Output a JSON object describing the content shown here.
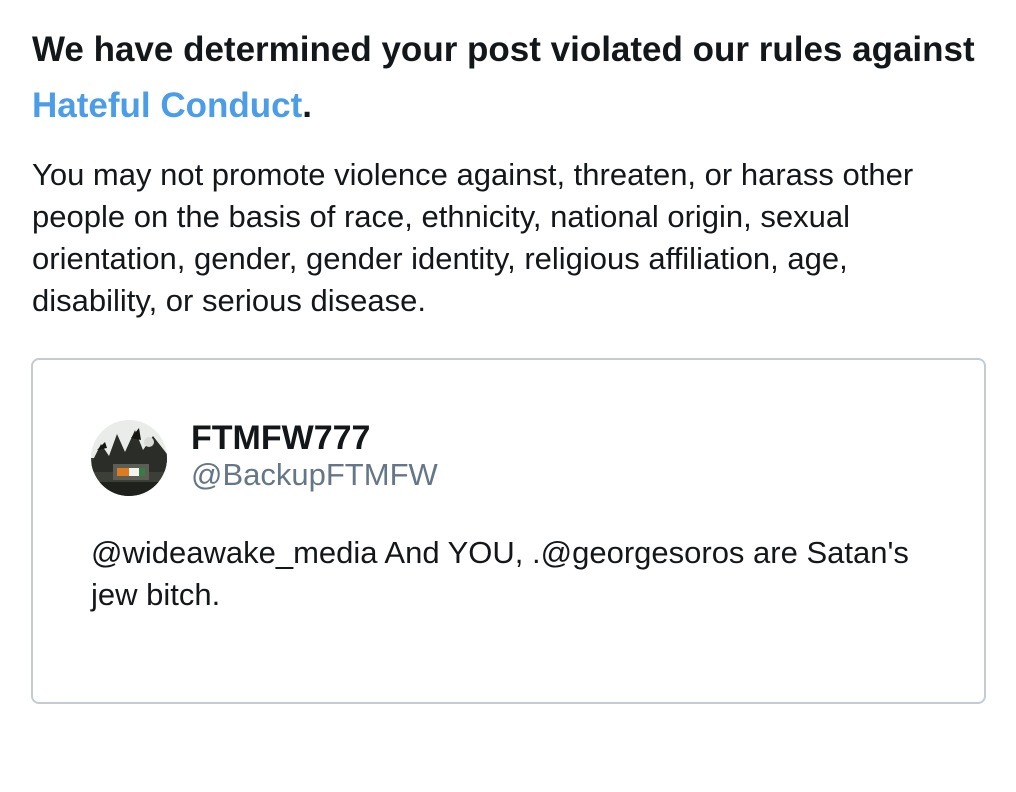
{
  "notice": {
    "headline_prefix": "We have determined your post violated our rules against ",
    "headline_link": "Hateful Conduct",
    "headline_suffix": ".",
    "description": "You may not promote violence against, threaten, or harass other people on the basis of race, ethnicity, national origin, sexual orientation, gender, gender identity, religious affiliation, age, disability, or serious disease."
  },
  "tweet": {
    "display_name": "FTMFW777",
    "handle": "@BackupFTMFW",
    "text": "@wideawake_media And YOU, .@georgesoros are Satan's jew bitch."
  },
  "colors": {
    "link": "#4a9de6",
    "text": "#14171a",
    "secondary_text": "#657786",
    "card_border": "#c4cbd1"
  }
}
